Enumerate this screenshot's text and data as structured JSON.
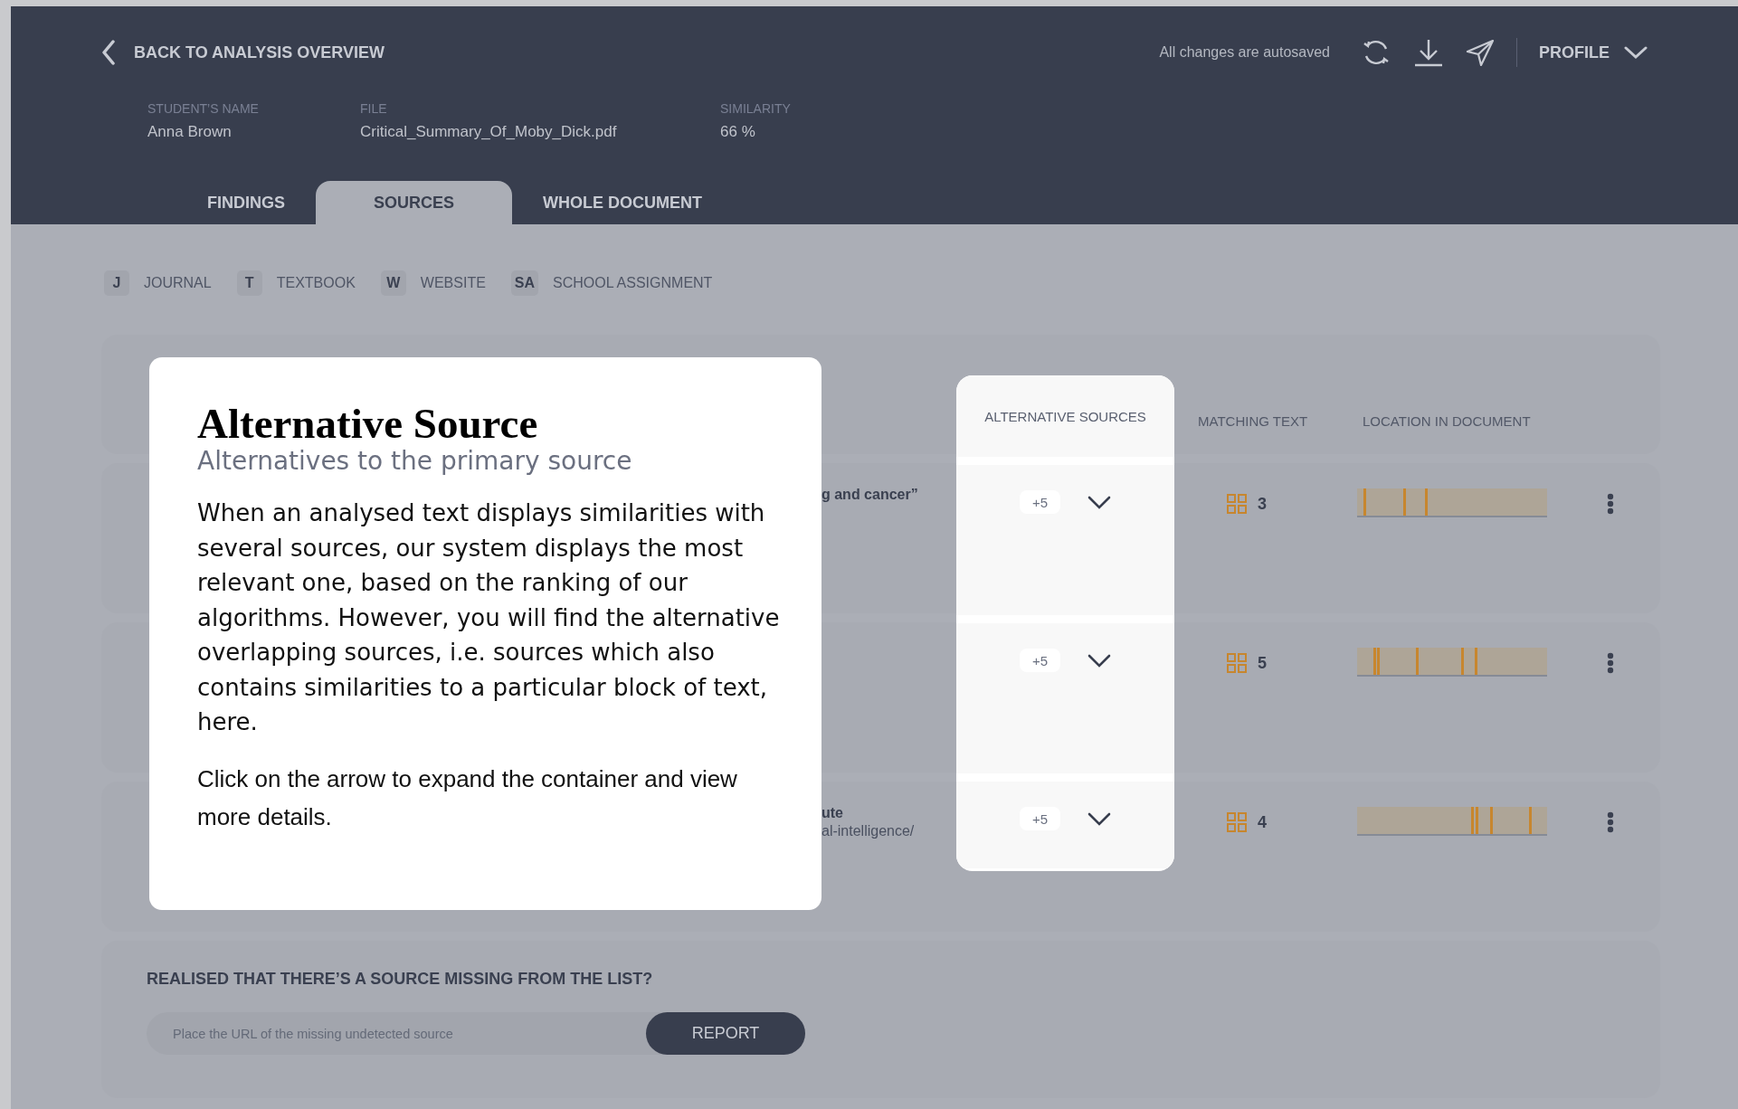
{
  "header": {
    "back_label": "BACK TO ANALYSIS OVERVIEW",
    "autosave_status": "All changes are autosaved",
    "profile_label": "PROFILE"
  },
  "meta": [
    {
      "label": "STUDENT’S NAME",
      "value": "Anna Brown"
    },
    {
      "label": "FILE",
      "value": "Critical_Summary_Of_Moby_Dick.pdf"
    },
    {
      "label": "SIMILARITY",
      "value": "66 %"
    }
  ],
  "tabs": [
    {
      "label": "FINDINGS",
      "selected": false
    },
    {
      "label": "SOURCES",
      "selected": true
    },
    {
      "label": "WHOLE DOCUMENT",
      "selected": false
    }
  ],
  "legend": [
    {
      "badge": "J",
      "label": "JOURNAL"
    },
    {
      "badge": "T",
      "label": "TEXTBOOK"
    },
    {
      "badge": "W",
      "label": "WEBSITE"
    },
    {
      "badge": "SA",
      "label": "SCHOOL ASSIGNMENT"
    }
  ],
  "table": {
    "columns": [
      "ALTERNATIVE SOURCES",
      "MATCHING TEXT",
      "LOCATION IN DOCUMENT"
    ],
    "rows": [
      {
        "source_title": "g and cancer”",
        "alternatives": "+5",
        "matching_count": "3",
        "markers": [
          {
            "level": 0.035
          },
          {
            "level": 0.245
          },
          {
            "level": 0.36
          }
        ]
      },
      {
        "alternatives": "+5",
        "matching_count": "5",
        "markers": [
          {
            "level": 0.088
          },
          {
            "level": 0.105
          },
          {
            "level": 0.316
          },
          {
            "level": 0.556
          },
          {
            "level": 0.626
          }
        ]
      },
      {
        "source_title": "ute",
        "source_url": "al-intelligence/",
        "alternatives": "+5",
        "matching_count": "4",
        "markers": [
          {
            "level": 0.608
          },
          {
            "level": 0.632
          },
          {
            "level": 0.708
          },
          {
            "level": 0.918
          }
        ]
      }
    ]
  },
  "report": {
    "title": "REALISED THAT THERE’S A SOURCE MISSING FROM THE LIST?",
    "placeholder": "Place the URL of the missing undetected source",
    "button": "REPORT"
  },
  "tooltip": {
    "title": "Alternative Source",
    "subtitle": "Alternatives to the primary source",
    "paragraphs": [
      {
        "kind": "body",
        "text": "When an analysed text displays similarities with several sources, our system displays the most relevant one, based on the ranking of our algorithms.  However, you will find the alternative overlapping sources, i.e. sources which also contains similarities to a particular block of text, here."
      },
      {
        "kind": "hint",
        "text": "Click on the arrow to expand the container and view more details."
      }
    ]
  }
}
